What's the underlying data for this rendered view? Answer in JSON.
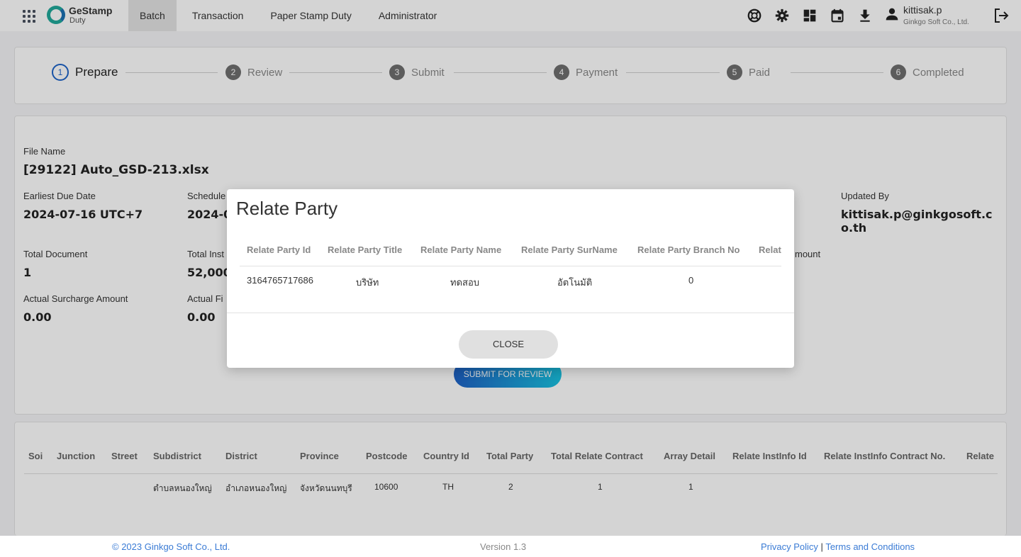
{
  "header": {
    "logo_title": "GeStamp",
    "logo_subtitle": "Duty",
    "nav": [
      "Batch",
      "Transaction",
      "Paper Stamp Duty",
      "Administrator"
    ],
    "active_nav": "Batch",
    "icons": [
      "support-icon",
      "settings-icon",
      "dashboard-icon",
      "calendar-icon",
      "download-icon"
    ],
    "user_name": "kittisak.p",
    "user_org": "Ginkgo Soft Co., Ltd."
  },
  "stepper": {
    "steps": [
      {
        "num": "1",
        "label": "Prepare"
      },
      {
        "num": "2",
        "label": "Review"
      },
      {
        "num": "3",
        "label": "Submit"
      },
      {
        "num": "4",
        "label": "Payment"
      },
      {
        "num": "5",
        "label": "Paid"
      },
      {
        "num": "6",
        "label": "Completed"
      }
    ],
    "active_step": 1
  },
  "info": {
    "file_name_label": "File Name",
    "file_name_value": "[29122] Auto_GSD-213.xlsx",
    "earliest_due_label": "Earliest Due Date",
    "earliest_due_value": "2024-07-16 UTC+7",
    "schedule_label": "Schedule",
    "schedule_value": "2024-0",
    "updated_by_label": "Updated By",
    "updated_by_value": "kittisak.p@ginkgosoft.co.th",
    "total_document_label": "Total Document",
    "total_document_value": "1",
    "total_inst_label": "Total Inst",
    "total_inst_value": "52,000",
    "amount_label_fragment": "mount",
    "actual_surcharge_label": "Actual Surcharge Amount",
    "actual_surcharge_value": "0.00",
    "actual_fi_label": "Actual Fi",
    "actual_fi_value": "0.00",
    "submit_button": "SUBMIT FOR REVIEW"
  },
  "detail_table": {
    "headers": [
      "Soi",
      "Junction",
      "Street",
      "Subdistrict",
      "District",
      "Province",
      "Postcode",
      "Country Id",
      "Total Party",
      "Total Relate Contract",
      "Array Detail",
      "Relate InstInfo Id",
      "Relate InstInfo Contract No.",
      "Relate"
    ],
    "row": [
      "",
      "",
      "",
      "ตำบลหนองใหญ่",
      "อำเภอหนองใหญ่",
      "จังหวัดนนทบุรี",
      "10600",
      "TH",
      "2",
      "1",
      "1",
      "",
      "",
      ""
    ]
  },
  "modal": {
    "title": "Relate Party",
    "headers": [
      "Relate Party Id",
      "Relate Party Title",
      "Relate Party Name",
      "Relate Party SurName",
      "Relate Party Branch No",
      "Relat"
    ],
    "row": [
      "3164765717686",
      "บริษัท",
      "ทดสอบ",
      "อัตโนมัติ",
      "0",
      ""
    ],
    "close_button": "CLOSE"
  },
  "footer": {
    "copyright": "© 2023 Ginkgo Soft Co., Ltd.",
    "version": "Version 1.3",
    "privacy": "Privacy Policy",
    "separator": "|",
    "terms": "Terms and Conditions"
  }
}
